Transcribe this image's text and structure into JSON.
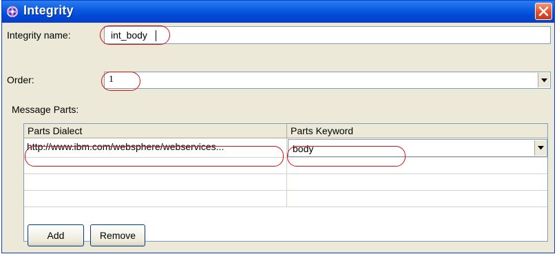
{
  "window": {
    "title": "Integrity"
  },
  "form": {
    "name_label": "Integrity name:",
    "name_value": "int_body",
    "order_label": "Order:",
    "order_value": "1"
  },
  "message_parts": {
    "label": "Message Parts:",
    "columns": [
      "Parts Dialect",
      "Parts Keyword"
    ],
    "rows": [
      {
        "dialect": "http://www.ibm.com/websphere/webservices...",
        "keyword": "body"
      }
    ]
  },
  "buttons": {
    "add": "Add",
    "remove": "Remove"
  },
  "colors": {
    "titlebar": "#0a5fe0",
    "close": "#e2502f",
    "highlight": "#d21010",
    "field_border": "#7f9db9"
  },
  "icons": {
    "title": "integrity-cross-icon",
    "close": "close-icon",
    "dropdown": "chevron-down-icon"
  }
}
